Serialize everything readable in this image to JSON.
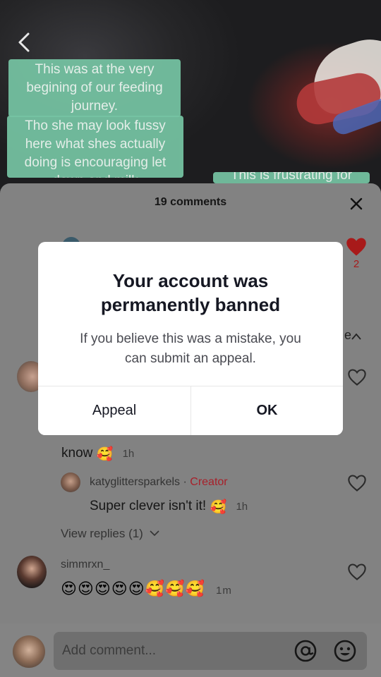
{
  "video": {
    "captions": [
      [
        "This was at the very",
        "begining of our feeding",
        "journey."
      ],
      [
        "Tho she may look fussy",
        "here what shes actually",
        "doing is encouraging let",
        "down and milk"
      ],
      [
        "This is frustrating for"
      ]
    ]
  },
  "comments_sheet": {
    "title": "19 comments",
    "top_like_count": "2",
    "peek_text": "e",
    "comments": [
      {
        "text": "know",
        "emoji": "🥰",
        "time": "1h"
      },
      {
        "username": "katyglittersparkels",
        "separator": " · ",
        "badge": "Creator",
        "text": "Super clever isn't it!",
        "emoji": "🥰",
        "time": "1h"
      },
      {
        "view_replies": "View replies (1)"
      },
      {
        "username": "simmrxn_",
        "emojis": "😍😍😍😍😍🥰🥰🥰",
        "time": "1m"
      }
    ]
  },
  "bottom_bar": {
    "placeholder": "Add comment..."
  },
  "modal": {
    "title_line1": "Your account was",
    "title_line2": "permanently banned",
    "body_line1": "If you believe this was a mistake, you",
    "body_line2": "can submit an appeal.",
    "appeal_label": "Appeal",
    "ok_label": "OK"
  },
  "colors": {
    "caption_bg": "#76c5a4",
    "like_red": "#a81a1a",
    "creator_red": "#a8202a",
    "overlay_sheet": "#828282"
  }
}
